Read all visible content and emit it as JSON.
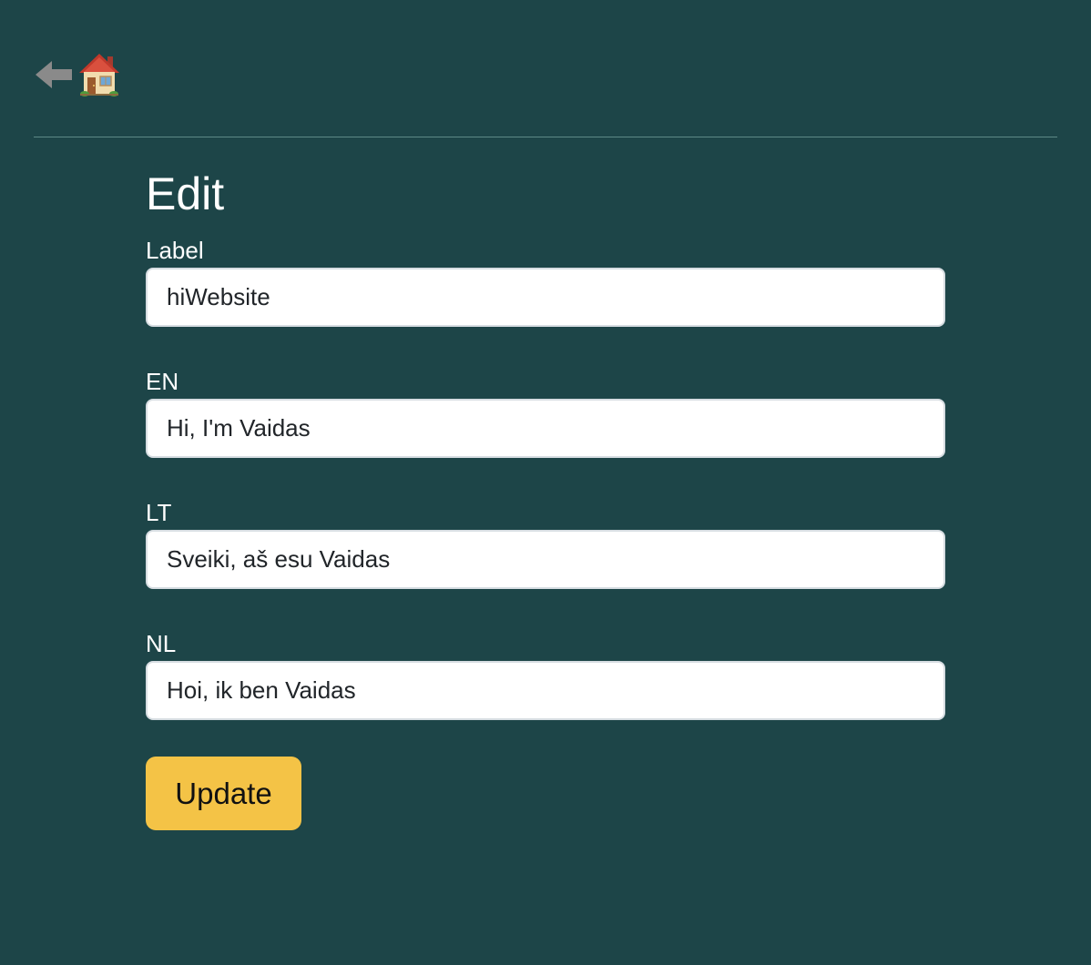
{
  "nav": {
    "back_icon": "back-arrow-icon",
    "home_icon": "house-icon"
  },
  "colors": {
    "background": "#1d4548",
    "divider": "#5d8a86",
    "button": "#f4c346",
    "input_bg": "#ffffff"
  },
  "page": {
    "title": "Edit"
  },
  "form": {
    "fields": [
      {
        "label": "Label",
        "value": "hiWebsite"
      },
      {
        "label": "EN",
        "value": "Hi, I'm Vaidas"
      },
      {
        "label": "LT",
        "value": "Sveiki, aš esu Vaidas"
      },
      {
        "label": "NL",
        "value": "Hoi, ik ben Vaidas"
      }
    ],
    "submit_label": "Update"
  }
}
